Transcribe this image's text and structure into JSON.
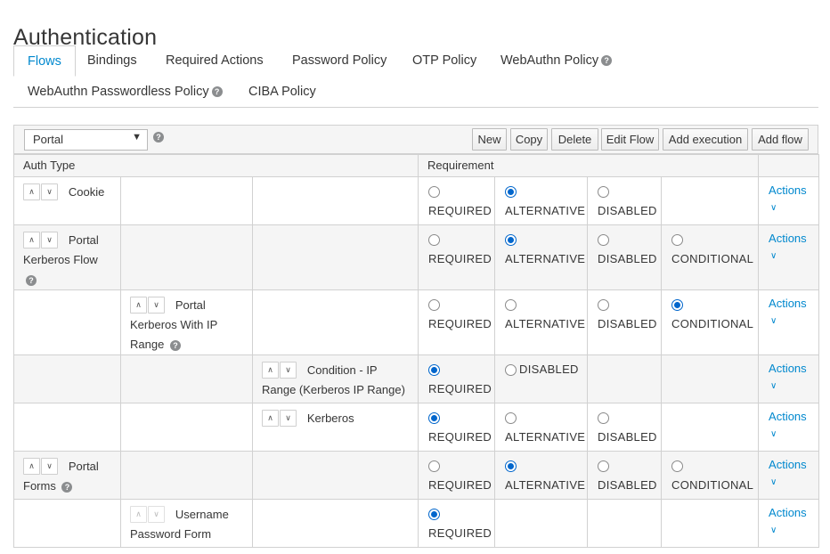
{
  "page": {
    "title": "Authentication"
  },
  "tabs": [
    {
      "label": "Flows",
      "active": true
    },
    {
      "label": "Bindings"
    },
    {
      "label": "Required Actions"
    },
    {
      "label": "Password Policy"
    },
    {
      "label": "OTP Policy"
    },
    {
      "label": "WebAuthn Policy",
      "help": true
    },
    {
      "label": "WebAuthn Passwordless Policy",
      "help": true
    },
    {
      "label": "CIBA Policy"
    }
  ],
  "help_glyph": "?",
  "toolbar": {
    "flow_select_value": "Portal",
    "buttons": {
      "new": "New",
      "copy": "Copy",
      "delete": "Delete",
      "edit_flow": "Edit Flow",
      "add_execution": "Add execution",
      "add_flow": "Add flow"
    }
  },
  "table": {
    "headers": {
      "auth_type": "Auth Type",
      "requirement": "Requirement"
    },
    "actions_label": "Actions",
    "options": {
      "required": "REQUIRED",
      "alternative": "ALTERNATIVE",
      "disabled": "DISABLED",
      "conditional": "CONDITIONAL"
    },
    "rows": [
      {
        "name": "Cookie",
        "level": 0,
        "help": false,
        "selected": "alternative",
        "has_conditional": false
      },
      {
        "name": "Portal Kerberos Flow",
        "level": 0,
        "help": true,
        "selected": "alternative",
        "has_conditional": true
      },
      {
        "name": "Portal Kerberos With IP Range",
        "level": 1,
        "help": true,
        "selected": "conditional",
        "has_conditional": true
      },
      {
        "name": "Condition - IP Range (Kerberos IP Range)",
        "level": 2,
        "help": false,
        "selected": "required",
        "condition_row": true
      },
      {
        "name": "Kerberos",
        "level": 2,
        "help": false,
        "selected": "required",
        "has_conditional": false
      },
      {
        "name": "Portal Forms",
        "level": 0,
        "help": true,
        "selected": "alternative",
        "has_conditional": true
      },
      {
        "name": "Username Password Form",
        "level": 1,
        "help": false,
        "selected": "required",
        "only_required": true
      }
    ]
  }
}
